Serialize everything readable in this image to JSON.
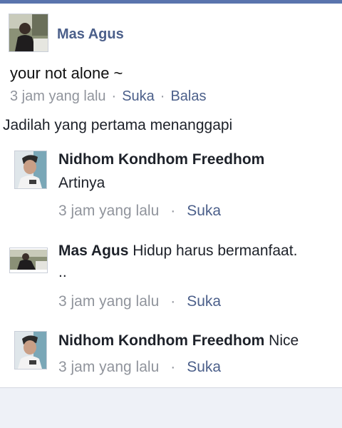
{
  "post": {
    "author": "Mas Agus",
    "text": "your not alone ~",
    "time": "3 jam yang lalu",
    "sep": "·",
    "like_label": "Suka",
    "reply_label": "Balas"
  },
  "replies_header": "Jadilah yang pertama menanggapi",
  "comments": [
    {
      "author": "Nidhom Kondhom Freedhom",
      "text": "Artinya",
      "time": "3 jam yang lalu",
      "like_label": "Suka"
    },
    {
      "author": "Mas Agus",
      "text": "Hidup harus bermanfaat.",
      "text2": "..",
      "time": "3 jam yang lalu",
      "like_label": "Suka"
    },
    {
      "author": "Nidhom Kondhom Freedhom",
      "text": "Nice",
      "time": "3 jam yang lalu",
      "like_label": "Suka"
    }
  ],
  "colors": {
    "accent": "#4b5f8a",
    "meta": "#90949c",
    "top_bar": "#5a74ad",
    "background": "#eef1f7"
  },
  "icons": [
    "avatar-mas-agus",
    "avatar-nidhom"
  ]
}
